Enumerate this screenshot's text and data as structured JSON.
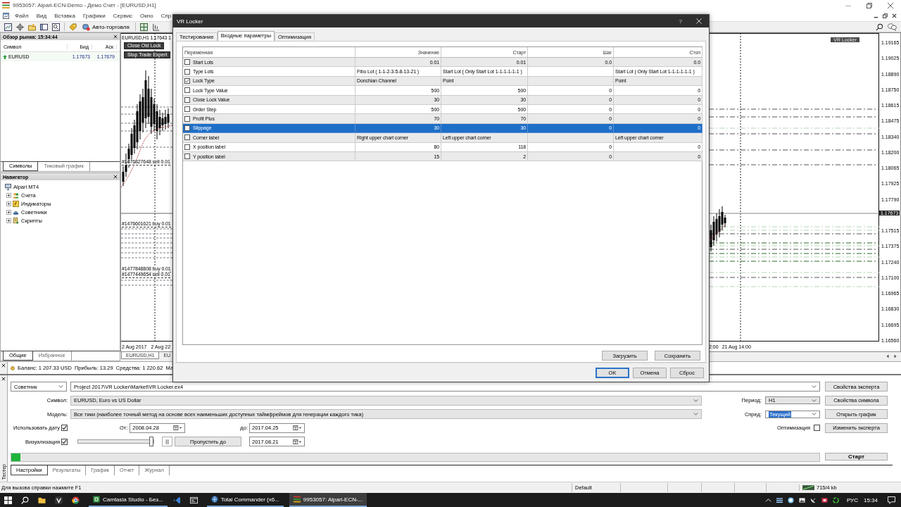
{
  "window": {
    "title": "9953057: Alpari-ECN-Demo - Демо Счет - [EURUSD,H1]"
  },
  "menu": [
    "Файл",
    "Вид",
    "Вставка",
    "Графики",
    "Сервис",
    "Окно",
    "Спр"
  ],
  "toolbar": {
    "auto_trading": "Авто-торговля"
  },
  "market_watch": {
    "title": "Обзор рынка: 15:34:44",
    "columns": [
      "Символ",
      "Бид",
      "Аск"
    ],
    "rows": [
      {
        "symbol": "EURUSD",
        "bid": "1.17673",
        "ask": "1.17679"
      }
    ],
    "tabs": [
      {
        "label": "Символы",
        "selected": true
      },
      {
        "label": "Тиковый график",
        "selected": false
      }
    ]
  },
  "navigator": {
    "title": "Навигатор",
    "tree": [
      {
        "label": "Alpari MT4",
        "children": [
          {
            "label": "Счета",
            "kind": "accounts",
            "expanded": false
          },
          {
            "label": "Индикаторы",
            "kind": "indicators",
            "expanded": false
          },
          {
            "label": "Советники",
            "kind": "experts",
            "expanded": false
          },
          {
            "label": "Скрипты",
            "kind": "scripts",
            "expanded": false
          }
        ]
      }
    ],
    "tabs": [
      {
        "label": "Общие",
        "selected": true
      },
      {
        "label": "Избранное",
        "selected": false
      }
    ]
  },
  "chart": {
    "header": "EURUSD,H1 1.17643 1",
    "buttons": [
      "Close Old Lock",
      "Stop Trade Expert"
    ],
    "orders": [
      "#1476827648 sell 0.01",
      "#1476601621 buy 0.01",
      "#1477848808 buy 0.01",
      "#1477449654 sell 0.01"
    ],
    "time_axis_left": [
      "2 Aug 2017",
      "2 Aug 22"
    ],
    "label": "VR Locker",
    "time_axis_right": [
      "2:00",
      "21 Aug 14:00"
    ],
    "price_axis": [
      "1.19165",
      "1.19025",
      "1.18890",
      "1.18750",
      "1.18615",
      "1.18475",
      "1.18340",
      "1.18200",
      "1.18065",
      "1.17925",
      "1.17790",
      "1.17515",
      "1.17375",
      "1.17240",
      "1.17100",
      "1.16965",
      "1.16830",
      "1.16695",
      "1.16560"
    ],
    "current_price": "1.17673",
    "tabs": [
      {
        "label": "EURUSD,H1",
        "selected": true
      },
      {
        "label": "EU",
        "selected": false
      }
    ]
  },
  "terminal": {
    "summary": "Баланс: 1 207.33 USD  Прибыль: 13.29  Средства: 1 220.62  Ма"
  },
  "dialog": {
    "title": "VR Locker",
    "help": "?",
    "tabs": [
      {
        "label": "Тестирование",
        "selected": false
      },
      {
        "label": "Входные параметры",
        "selected": true
      },
      {
        "label": "Оптимизация",
        "selected": false
      }
    ],
    "table": {
      "columns": [
        "Переменная",
        "Значение",
        "Старт",
        "Шаг",
        "Стоп"
      ],
      "rows": [
        {
          "name": "Start Lots",
          "kind": "number",
          "checked": false,
          "selected": false,
          "value": "0.01",
          "start": "0.01",
          "step": "0.0",
          "stop": "0.0"
        },
        {
          "name": "Type Lots",
          "kind": "list",
          "checked": false,
          "selected": false,
          "value": "Fibo Lot ( 1-1-2-3-5-8-13-21 )",
          "start": "Start Lot ( Only Start Lot 1-1-1-1-1-1 )",
          "stop": "Start Lot ( Only Start Lot 1-1-1-1-1-1 )"
        },
        {
          "name": "Lock Type",
          "kind": "list",
          "checked": true,
          "selected": false,
          "value": "Donchian Channel",
          "start": "Point",
          "stop": "Point"
        },
        {
          "name": "Lock Type Value",
          "kind": "number",
          "checked": false,
          "selected": false,
          "value": "500",
          "start": "500",
          "step": "0",
          "stop": "0"
        },
        {
          "name": "Close Lock Value",
          "kind": "number",
          "checked": false,
          "selected": false,
          "value": "30",
          "start": "30",
          "step": "0",
          "stop": "0"
        },
        {
          "name": "Order Step",
          "kind": "number",
          "checked": false,
          "selected": false,
          "value": "500",
          "start": "500",
          "step": "0",
          "stop": "0"
        },
        {
          "name": "Profit Plus",
          "kind": "number",
          "checked": false,
          "selected": false,
          "value": "70",
          "start": "70",
          "step": "0",
          "stop": "0"
        },
        {
          "name": "Slippage",
          "kind": "number",
          "checked": false,
          "selected": true,
          "value": "30",
          "start": "30",
          "step": "0",
          "stop": "0"
        },
        {
          "name": "Corner label",
          "kind": "list",
          "checked": false,
          "selected": false,
          "value": "Right upper chart corner",
          "start": "Left upper chart corner",
          "stop": "Left upper chart corner"
        },
        {
          "name": "X position label",
          "kind": "number",
          "checked": false,
          "selected": false,
          "value": "80",
          "start": "118",
          "step": "0",
          "stop": "0"
        },
        {
          "name": "Y position label",
          "kind": "number",
          "checked": false,
          "selected": false,
          "value": "15",
          "start": "2",
          "step": "0",
          "stop": "0"
        }
      ]
    },
    "buttons": [
      "Загрузить",
      "Сохранить"
    ],
    "footer_buttons": [
      {
        "label": "OK",
        "default": true
      },
      {
        "label": "Отмена",
        "default": false
      },
      {
        "label": "Сброс",
        "default": false
      }
    ]
  },
  "tester": {
    "panel_label": "Тестер",
    "mode": "Советник",
    "expert": "Project 2017\\VR Locker\\Market\\VR Locker.ex4",
    "symbol": {
      "label": "Символ:",
      "value": "EURUSD, Euro vs US Dollar"
    },
    "model": {
      "label": "Модель:",
      "value": "Все тики (наиболее точный метод на основе всех наименьших доступных таймфреймов для генерации каждого тика)"
    },
    "use_date": {
      "label": "Использовать дату",
      "checked": true
    },
    "from": {
      "label": "От:",
      "value": "2008.04.28"
    },
    "to": {
      "label": "до:",
      "value": "2017.04.25"
    },
    "visual": {
      "label": "Визуализация",
      "checked": true,
      "level": 0.97
    },
    "skip": {
      "button": "Пропустить до",
      "value": "2017.08.21"
    },
    "period": {
      "label": "Период:",
      "value": "H1"
    },
    "spread": {
      "label": "Спред:",
      "value": "Текущий",
      "text_selected": true
    },
    "optimization": {
      "label": "Оптимизация",
      "checked": false
    },
    "buttons": [
      "Свойства эксперта",
      "Свойства символа",
      "Открыть график",
      "Изменить эксперта"
    ],
    "start": "Старт",
    "progress": {
      "level": 0.011
    },
    "tabs": [
      {
        "label": "Настройки",
        "selected": true
      },
      {
        "label": "Результаты",
        "selected": false
      },
      {
        "label": "График",
        "selected": false
      },
      {
        "label": "Отчет",
        "selected": false
      },
      {
        "label": "Журнал",
        "selected": false
      }
    ]
  },
  "status_bar": {
    "help": "Для вызова справки нажмите F1",
    "profile": "Default",
    "traffic": "715/4 kb"
  },
  "taskbar": {
    "windows": [
      {
        "label": "Camtasia Studio - Без...",
        "selected": false
      },
      {
        "label": "Total Commander (x6...",
        "selected": false
      },
      {
        "label": "9953057: Alpari-ECN-...",
        "selected": true
      }
    ],
    "language": "РУС",
    "time": "15:34"
  }
}
